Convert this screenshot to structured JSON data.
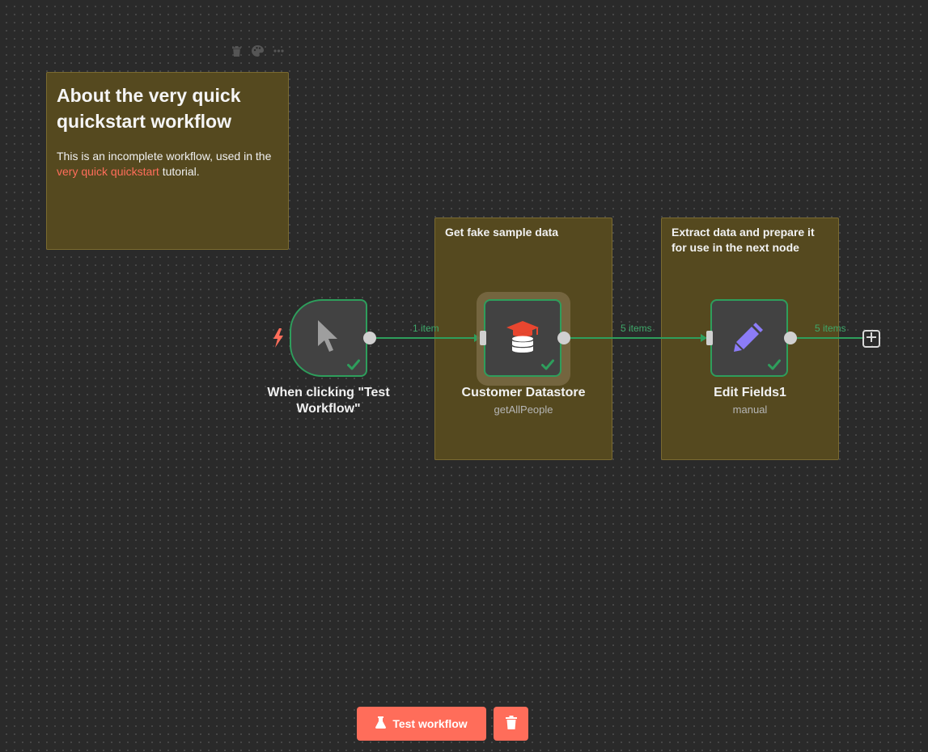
{
  "canvas": {
    "background": "#2a2a2a",
    "accent": "#ff6d5a",
    "success": "#2e9e5c"
  },
  "sticky_toolbar": {
    "icons": [
      "trash-icon",
      "palette-icon",
      "more-icon"
    ]
  },
  "about_note": {
    "title": "About the very quick quickstart workflow",
    "text_before": "This is an incomplete workflow, used in the ",
    "link_text": "very quick quickstart",
    "text_after": " tutorial."
  },
  "group_notes": {
    "fake_data": "Get fake sample data",
    "extract": "Extract data and prepare it for use in the next node"
  },
  "nodes": {
    "trigger": {
      "title": "When clicking \"Test Workflow\"",
      "icon": "cursor-icon"
    },
    "datastore": {
      "title": "Customer Datastore",
      "subtitle": "getAllPeople",
      "icon": "graduation-database-icon"
    },
    "edit": {
      "title": "Edit Fields1",
      "subtitle": "manual",
      "icon": "pencil-icon"
    }
  },
  "connections": {
    "trigger_to_datastore": "1 item",
    "datastore_to_edit": "5 items",
    "edit_output": "5 items"
  },
  "toolbar": {
    "test_label": "Test workflow",
    "test_icon": "flask-icon",
    "delete_icon": "trash-icon"
  }
}
